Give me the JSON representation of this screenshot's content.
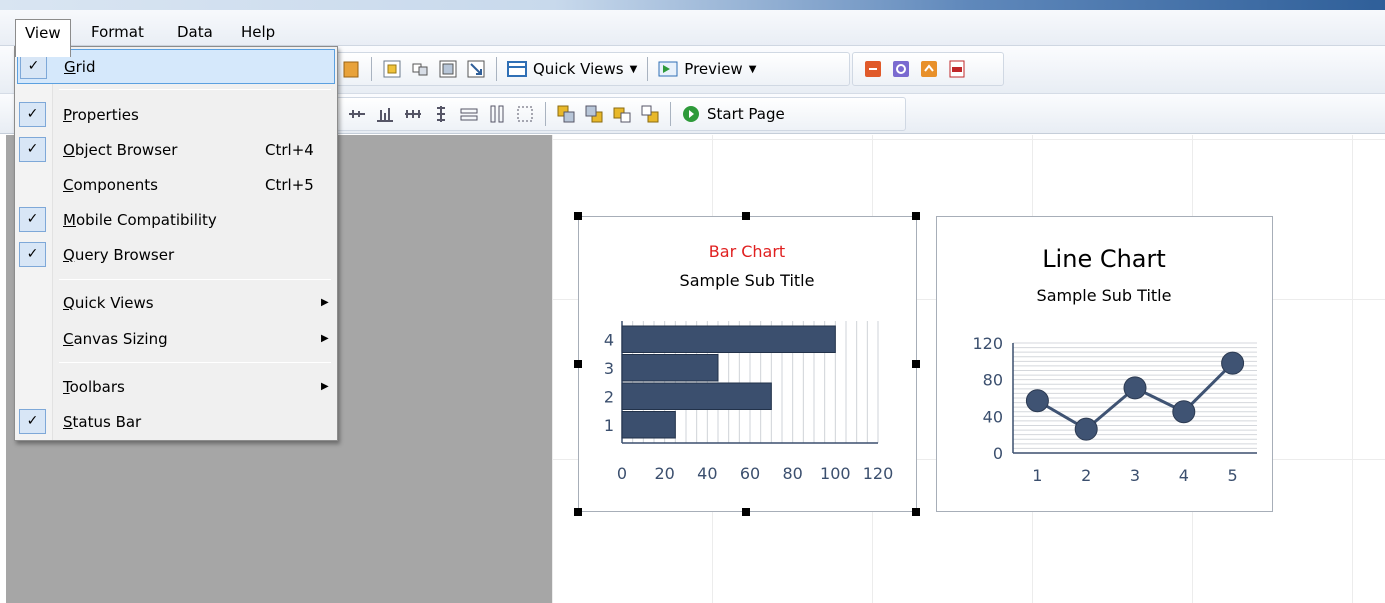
{
  "menubar": {
    "items": [
      {
        "label": "View",
        "open": true
      },
      {
        "label": "Format"
      },
      {
        "label": "Data"
      },
      {
        "label": "Help"
      }
    ]
  },
  "toolbar": {
    "quick_views_label": "Quick Views",
    "preview_label": "Preview",
    "start_page_label": "Start Page"
  },
  "view_menu": {
    "items": [
      {
        "label": "Grid",
        "checked": true,
        "highlighted": true
      },
      {
        "label": "Properties",
        "checked": true
      },
      {
        "label": "Object Browser",
        "checked": true,
        "shortcut": "Ctrl+4"
      },
      {
        "label": "Components",
        "checked": false,
        "shortcut": "Ctrl+5"
      },
      {
        "label": "Mobile Compatibility",
        "checked": true
      },
      {
        "label": "Query Browser",
        "checked": true
      },
      {
        "label": "Quick Views",
        "submenu": true
      },
      {
        "label": "Canvas Sizing",
        "submenu": true
      },
      {
        "label": "Toolbars",
        "submenu": true
      },
      {
        "label": "Status Bar",
        "checked": true
      }
    ]
  },
  "colors": {
    "bar_fill": "#3b4f6e",
    "line_color": "#3f5373",
    "bar_title": "#e02020",
    "axis_text": "#3b4f6e"
  },
  "chart_data": [
    {
      "type": "bar",
      "orientation": "horizontal",
      "title": "Bar Chart",
      "subtitle": "Sample Sub Title",
      "categories": [
        "1",
        "2",
        "3",
        "4"
      ],
      "values": [
        25,
        70,
        45,
        100
      ],
      "xlim": [
        0,
        120
      ],
      "xticks": [
        "0",
        "20",
        "40",
        "60",
        "80",
        "100",
        "120"
      ],
      "grid": true,
      "selected": true
    },
    {
      "type": "line",
      "title": "Line Chart",
      "subtitle": "Sample Sub Title",
      "x": [
        "1",
        "2",
        "3",
        "4",
        "5"
      ],
      "values": [
        57,
        26,
        71,
        45,
        98
      ],
      "ylim": [
        0,
        120
      ],
      "yticks": [
        "0",
        "40",
        "80",
        "120"
      ],
      "grid": true
    }
  ]
}
